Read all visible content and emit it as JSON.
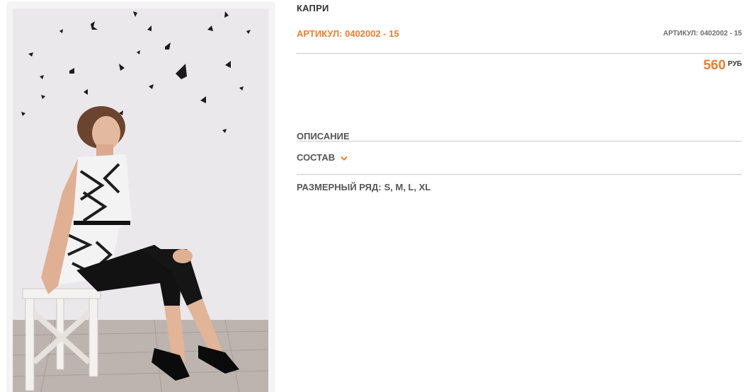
{
  "product": {
    "title": "КАПРИ",
    "article_label": "АРТИКУЛ: 0402002 - 15",
    "article_label_small": "АРТИКУЛ: 0402002 - 15",
    "price_value": "560",
    "price_currency": "РУБ"
  },
  "tabs": {
    "description": "ОПИСАНИЕ",
    "composition": "СОСТАВ"
  },
  "sizes": {
    "label": "РАЗМЕРНЫЙ РЯД:",
    "values": "S, M, L, XL"
  },
  "colors": {
    "accent": "#ef7d2f",
    "text": "#333333",
    "muted": "#555555",
    "divider": "#c9c9c9"
  },
  "icons": {
    "composition_toggle": "chevron-down-icon"
  }
}
